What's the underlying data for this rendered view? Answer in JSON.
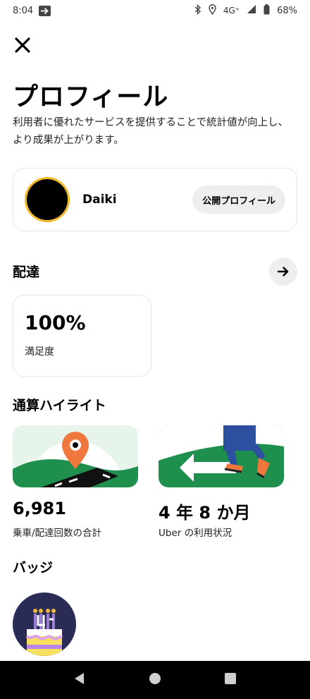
{
  "status_bar": {
    "time": "8:04",
    "network": "4G⁺",
    "battery": "68%"
  },
  "header": {
    "title": "プロフィール",
    "description": "利用者に優れたサービスを提供することで統計値が向上し、より成果が上がります。"
  },
  "profile": {
    "name": "Daiki",
    "public_profile_label": "公開プロフィール"
  },
  "delivery": {
    "section_title": "配達",
    "satisfaction_value": "100%",
    "satisfaction_label": "満足度"
  },
  "highlights": {
    "section_title": "通算ハイライト",
    "items": [
      {
        "value": "6,981",
        "label": "乗車/配達回数の合計"
      },
      {
        "value": "4 年 8 か月",
        "label": "Uber の利用状況"
      }
    ]
  },
  "badges": {
    "section_title": "バッジ"
  },
  "colors": {
    "accent_green": "#1f8f4e",
    "pin_orange": "#f0773e",
    "avatar_ring": "#f2b825",
    "card_border": "#e6e6e6"
  }
}
